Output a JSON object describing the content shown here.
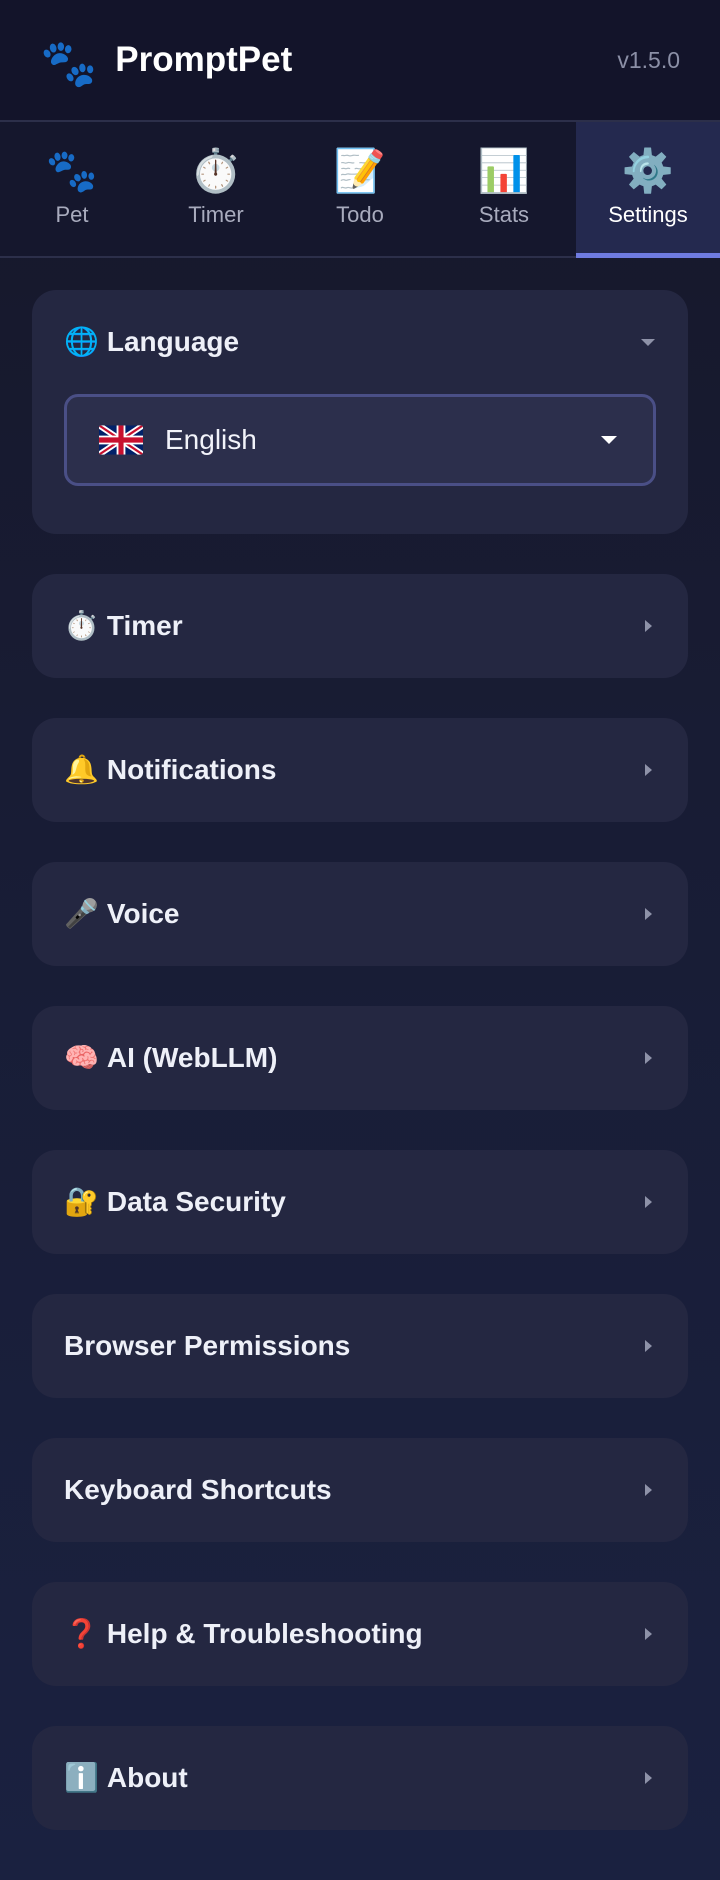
{
  "header": {
    "logo_icon": "🐾",
    "title": "PromptPet",
    "version": "v1.5.0"
  },
  "tabs": [
    {
      "icon": "🐾",
      "label": "Pet"
    },
    {
      "icon": "⏱️",
      "label": "Timer"
    },
    {
      "icon": "📝",
      "label": "Todo"
    },
    {
      "icon": "📊",
      "label": "Stats"
    },
    {
      "icon": "⚙️",
      "label": "Settings",
      "active": true
    }
  ],
  "settings": {
    "language": {
      "icon": "🌐",
      "title": "Language",
      "selected_flag": "uk-flag-icon",
      "selected_value": "English"
    },
    "sections": [
      {
        "icon": "⏱️",
        "title": "Timer"
      },
      {
        "icon": "🔔",
        "title": "Notifications"
      },
      {
        "icon": "🎤",
        "title": "Voice"
      },
      {
        "icon": "🧠",
        "title": "AI (WebLLM)"
      },
      {
        "icon": "🔐",
        "title": "Data Security"
      },
      {
        "icon": "",
        "title": "Browser Permissions"
      },
      {
        "icon": "",
        "title": "Keyboard Shortcuts"
      },
      {
        "icon": "❓",
        "title": "Help & Troubleshooting"
      },
      {
        "icon": "ℹ️",
        "title": "About"
      }
    ]
  },
  "colors": {
    "accent": "#6f7be0",
    "background": "#181c34",
    "card": "#242741"
  }
}
